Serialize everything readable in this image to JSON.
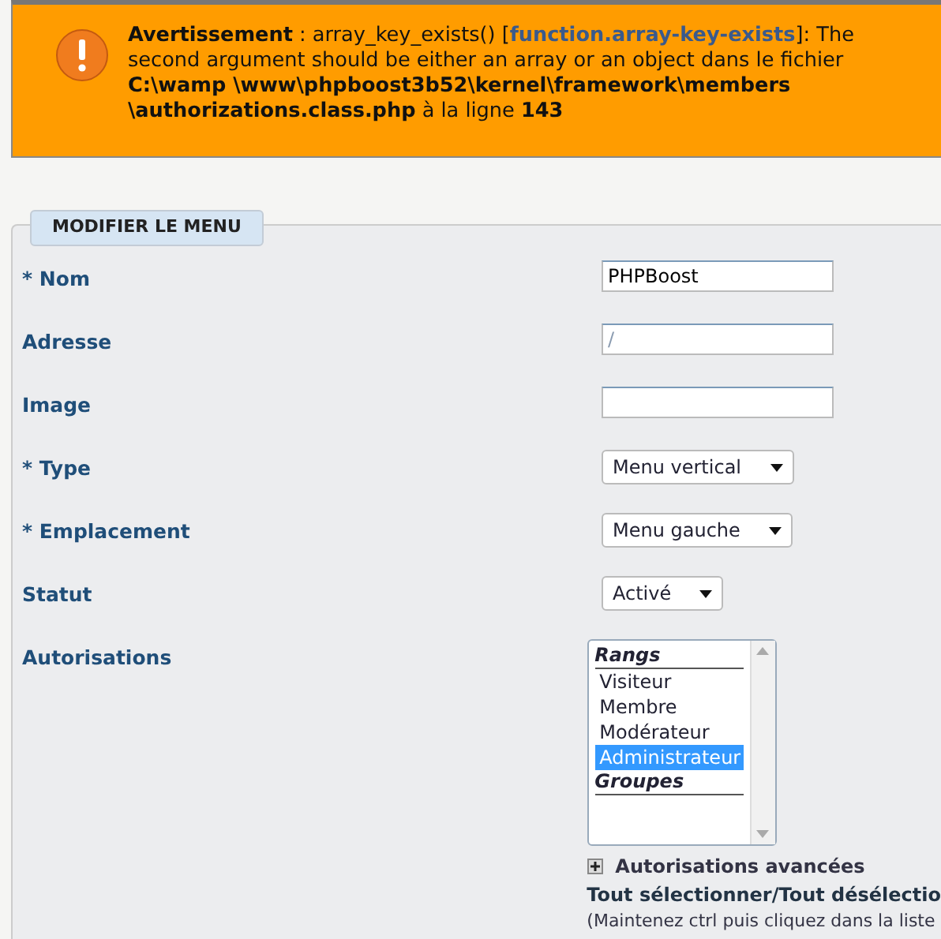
{
  "warning": {
    "parts": [
      {
        "kind": "bold",
        "text": "Avertissement"
      },
      {
        "kind": "text",
        "text": " : array_key_exists() ["
      },
      {
        "kind": "link",
        "text": "function.array-key-exists"
      },
      {
        "kind": "text",
        "text": "]: The second argument should be either an array or an object dans le fichier "
      },
      {
        "kind": "bold",
        "text": "C:\\wamp \\www\\phpboost3b52\\kernel\\framework\\members \\authorizations.class.php"
      },
      {
        "kind": "text",
        "text": " à la ligne "
      },
      {
        "kind": "bold",
        "text": "143"
      }
    ]
  },
  "form": {
    "legend": "MODIFIER LE MENU",
    "fields": [
      {
        "label": "* Nom",
        "kind": "text",
        "value": "PHPBoost"
      },
      {
        "label": "Adresse",
        "kind": "text",
        "placeholder": "/"
      },
      {
        "label": "Image",
        "kind": "text"
      },
      {
        "label": "* Type",
        "kind": "select",
        "value": "Menu vertical"
      },
      {
        "label": "* Emplacement",
        "kind": "select",
        "value": "Menu gauche"
      },
      {
        "label": "Statut",
        "kind": "select",
        "value": "Activé"
      },
      {
        "label": "Autorisations",
        "kind": "listbox",
        "options": [
          {
            "kind": "group",
            "text": "Rangs"
          },
          {
            "kind": "option",
            "text": "Visiteur",
            "selected": false
          },
          {
            "kind": "option",
            "text": "Membre",
            "selected": false
          },
          {
            "kind": "option",
            "text": "Modérateur",
            "selected": false
          },
          {
            "kind": "option",
            "text": "Administrateur",
            "selected": true
          },
          {
            "kind": "group",
            "text": "Groupes"
          }
        ],
        "advanced": "Autorisations avancées",
        "select_all": "Tout sélectionner",
        "separator": "/",
        "deselect_all": "Tout désélectio",
        "hint": "(Maintenez ctrl puis cliquez dans la liste"
      }
    ]
  }
}
